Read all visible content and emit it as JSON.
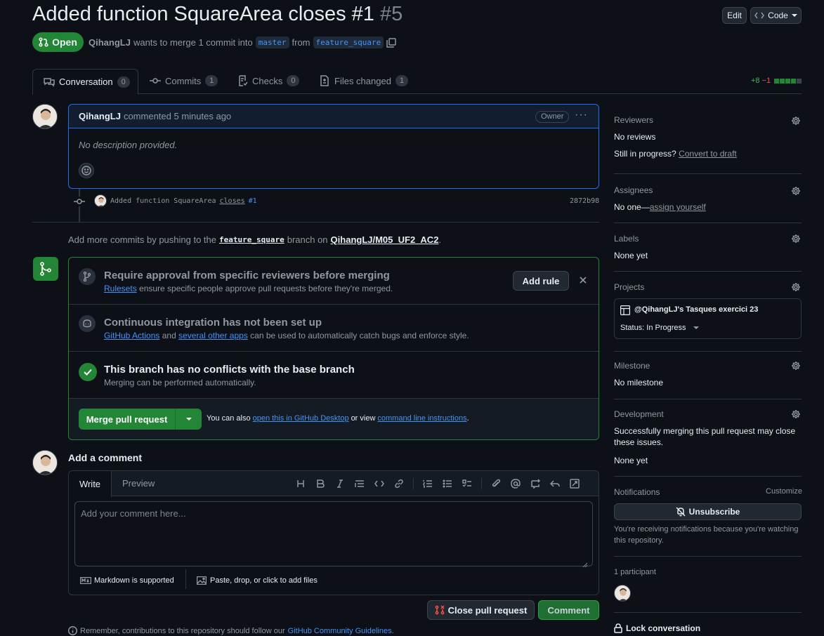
{
  "header": {
    "title": "Added function SquareArea closes #1",
    "number": "#5",
    "edit_label": "Edit",
    "code_label": "Code",
    "status": "Open",
    "author": "QihangLJ",
    "merge_text": "wants to merge 1 commit into",
    "base_branch": "master",
    "from_text": "from",
    "head_branch": "feature_square"
  },
  "tabs": [
    {
      "label": "Conversation",
      "count": "0"
    },
    {
      "label": "Commits",
      "count": "1"
    },
    {
      "label": "Checks",
      "count": "0"
    },
    {
      "label": "Files changed",
      "count": "1"
    }
  ],
  "diffstat": {
    "added": "+8",
    "removed": "−1"
  },
  "comment": {
    "author": "QihangLJ",
    "action": "commented 5 minutes ago",
    "badge": "Owner",
    "body": "No description provided."
  },
  "commit": {
    "message": "Added function SquareArea",
    "closes": "closes",
    "issue": "#1",
    "sha": "2872b98"
  },
  "push_hint": {
    "prefix": "Add more commits by pushing to the",
    "branch": "feature_square",
    "middle": "branch on",
    "repo": "QihangLJ/M05_UF2_AC2",
    "suffix": "."
  },
  "merge_box": {
    "rule_title": "Require approval from specific reviewers before merging",
    "rule_link": "Rulesets",
    "rule_desc": "ensure specific people approve pull requests before they're merged.",
    "add_rule": "Add rule",
    "ci_title": "Continuous integration has not been set up",
    "ci_link1": "GitHub Actions",
    "ci_and": "and",
    "ci_link2": "several other apps",
    "ci_desc": "can be used to automatically catch bugs and enforce style.",
    "conflict_title": "This branch has no conflicts with the base branch",
    "conflict_desc": "Merging can be performed automatically.",
    "merge_button": "Merge pull request",
    "also_text": "You can also",
    "desktop_link": "open this in GitHub Desktop",
    "or_view": "or view",
    "cli_link": "command line instructions",
    "period": "."
  },
  "add_comment": {
    "heading": "Add a comment",
    "tab_write": "Write",
    "tab_preview": "Preview",
    "placeholder": "Add your comment here...",
    "markdown": "Markdown is supported",
    "attach": "Paste, drop, or click to add files",
    "close_pr": "Close pull request",
    "comment_btn": "Comment",
    "remember": "Remember, contributions to this repository should follow our",
    "guidelines": "GitHub Community Guidelines",
    "remember_end": "."
  },
  "sidebar": {
    "reviewers": {
      "title": "Reviewers",
      "value": "No reviews",
      "progress": "Still in progress?",
      "convert": "Convert to draft"
    },
    "assignees": {
      "title": "Assignees",
      "value": "No one—",
      "assign": "assign yourself"
    },
    "labels": {
      "title": "Labels",
      "value": "None yet"
    },
    "projects": {
      "title": "Projects",
      "project_name": "@QihangLJ's Tasques exercici 23",
      "status": "Status: In Progress"
    },
    "milestone": {
      "title": "Milestone",
      "value": "No milestone"
    },
    "development": {
      "title": "Development",
      "desc": "Successfully merging this pull request may close these issues.",
      "value": "None yet"
    },
    "notifications": {
      "title": "Notifications",
      "customize": "Customize",
      "unsubscribe": "Unsubscribe",
      "desc": "You're receiving notifications because you're watching this repository."
    },
    "participants": {
      "title": "1 participant"
    },
    "lock": "Lock conversation"
  },
  "colors": {
    "green": "#238636",
    "open_green": "#238636",
    "link": "#4493f8",
    "danger": "#f85149",
    "bg": "#0d1117"
  }
}
